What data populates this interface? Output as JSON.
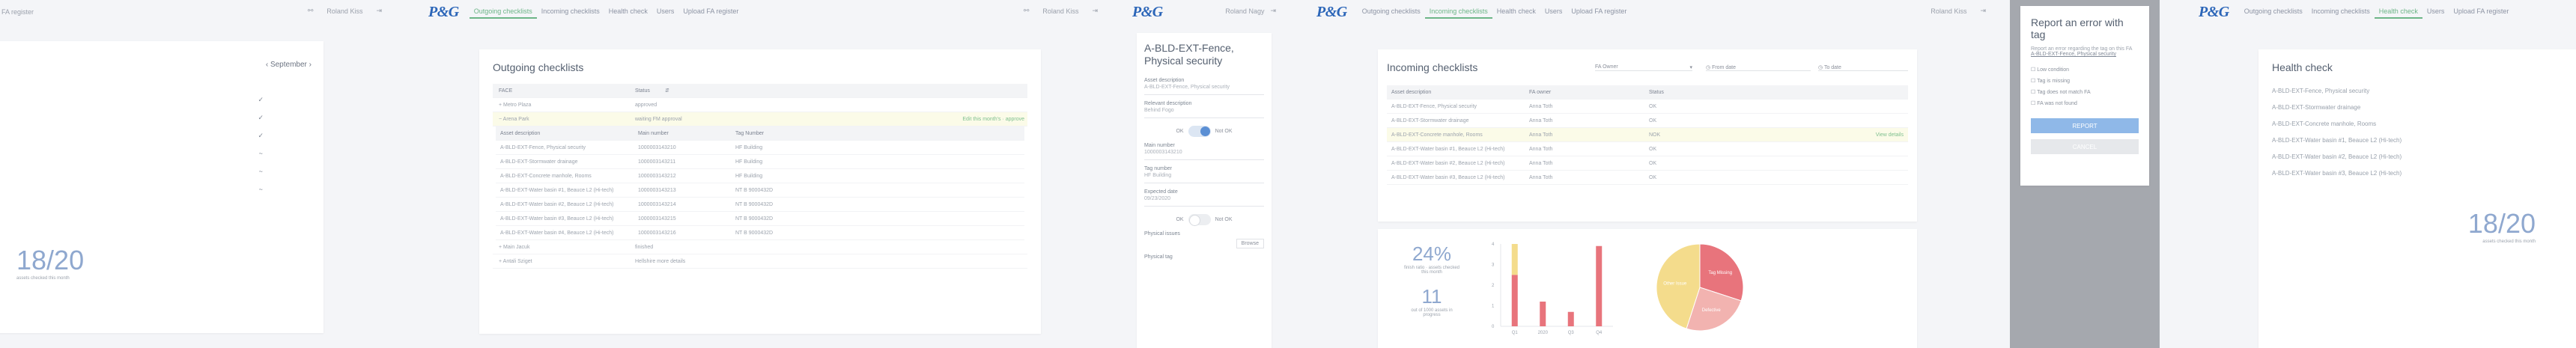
{
  "common": {
    "logo": "P&G",
    "user_name": "Roland Kiss",
    "nav": [
      "Outgoing checklists",
      "Incoming checklists",
      "Health check",
      "Users",
      "Upload FA register"
    ]
  },
  "panel1": {
    "nav_partial": "FA register",
    "month": "September",
    "checks": [
      "✓",
      "✓",
      "✓",
      "~",
      "~",
      "~"
    ],
    "big_stat": "18/20",
    "big_stat_caption": "assets checked this month"
  },
  "panel2": {
    "title": "Outgoing checklists",
    "header": {
      "col1": "FACE",
      "col2": "Status"
    },
    "groups": [
      {
        "name": "Metro Plaza",
        "status": "approved",
        "action": ""
      },
      {
        "name": "Arena Park",
        "status": "waiting FM approval",
        "action": "Edit this month's · approve"
      }
    ],
    "sub_header": {
      "c1": "Asset description",
      "c2": "Main number",
      "c3": "Tag Number"
    },
    "sub_rows": [
      {
        "c1": "A-BLD-EXT-Fence, Physical security",
        "c2": "1000003143210",
        "c3": "HF Building"
      },
      {
        "c1": "A-BLD-EXT-Stormwater drainage",
        "c2": "1000003143211",
        "c3": "HF Building"
      },
      {
        "c1": "A-BLD-EXT-Concrete manhole, Rooms",
        "c2": "1000003143212",
        "c3": "HF Building"
      },
      {
        "c1": "A-BLD-EXT-Water basin #1, Beauce L2 (Hi-tech)",
        "c2": "1000003143213",
        "c3": "NT B 9000432D"
      },
      {
        "c1": "A-BLD-EXT-Water basin #2, Beauce L2 (Hi-tech)",
        "c2": "1000003143214",
        "c3": "NT B 9000432D"
      },
      {
        "c1": "A-BLD-EXT-Water basin #3, Beauce L2 (Hi-tech)",
        "c2": "1000003143215",
        "c3": "NT B 9000432D"
      },
      {
        "c1": "A-BLD-EXT-Water basin #4, Beauce L2 (Hi-tech)",
        "c2": "1000003143216",
        "c3": "NT B 9000432D"
      }
    ],
    "footer_groups": [
      {
        "name": "Main Jacuk",
        "status": "finished"
      },
      {
        "name": "Antali Sziget",
        "status": "Hellshire more details"
      }
    ]
  },
  "panel3": {
    "user_name": "Roland Nagy",
    "title": "A-BLD-EXT-Fence, Physical security",
    "fields": [
      {
        "label": "Asset description",
        "value": "A-BLD-EXT-Fence, Physical security"
      },
      {
        "label": "Relevant description",
        "value": "Behind Fogo"
      }
    ],
    "toggle1": {
      "left": "OK",
      "right": "Not OK"
    },
    "fields2": [
      {
        "label": "Main number",
        "value": "1000003143210"
      },
      {
        "label": "Tag number",
        "value": "HF Building"
      },
      {
        "label": "Expected date",
        "value": "09/23/2020"
      }
    ],
    "toggle2": {
      "left": "OK",
      "right": "Not OK"
    },
    "photo_label": "Physical issues",
    "browse": "Browse",
    "last_label": "Physical tag"
  },
  "panel4": {
    "title": "Incoming checklists",
    "filters": {
      "select": "FA Owner",
      "from": "From date",
      "to": "To date"
    },
    "header": {
      "c1": "Asset description",
      "c2": "FA owner",
      "c3": "Status"
    },
    "rows": [
      {
        "c1": "A-BLD-EXT-Fence, Physical security",
        "c2": "Anna Toth",
        "c3": "OK",
        "action": ""
      },
      {
        "c1": "A-BLD-EXT-Stormwater drainage",
        "c2": "Anna Toth",
        "c3": "OK",
        "action": ""
      },
      {
        "c1": "A-BLD-EXT-Concrete manhole, Rooms",
        "c2": "Anna Toth",
        "c3": "NOK",
        "action": "View details"
      },
      {
        "c1": "A-BLD-EXT-Water basin #1, Beauce L2 (Hi-tech)",
        "c2": "Anna Toth",
        "c3": "OK",
        "action": ""
      },
      {
        "c1": "A-BLD-EXT-Water basin #2, Beauce L2 (Hi-tech)",
        "c2": "Anna Toth",
        "c3": "OK",
        "action": ""
      },
      {
        "c1": "A-BLD-EXT-Water basin #3, Beauce L2 (Hi-tech)",
        "c2": "Anna Toth",
        "c3": "OK",
        "action": ""
      }
    ],
    "stat1": "24%",
    "stat1_caption": "finish ratio · assets checked this month",
    "stat2": "11",
    "stat2_caption": "out of 1000 assets in progress",
    "colors": {
      "pink": "#e8747c",
      "yellow": "#f4dc8c",
      "light_pink": "#f2b3b0"
    }
  },
  "chart_data": {
    "type": "bar",
    "categories": [
      "Q1",
      "2020",
      "Q3",
      "Q4"
    ],
    "ylim": [
      0,
      4
    ],
    "yticks": [
      "4",
      "3",
      "2",
      "1",
      "0"
    ],
    "series": [
      {
        "values": [
          2.5,
          1.2,
          0.7,
          3.9
        ],
        "color": "#e8747c"
      },
      {
        "values": [
          1.5,
          0,
          0,
          0
        ],
        "color": "#f4dc8c"
      }
    ]
  },
  "pie_data": {
    "type": "pie",
    "slices": [
      {
        "label": "Tag Missing",
        "value": 30,
        "color": "#e8747c"
      },
      {
        "label": "Defective",
        "value": 25,
        "color": "#f2b3b0"
      },
      {
        "label": "Other Issue",
        "value": 45,
        "color": "#f4dc8c"
      }
    ]
  },
  "panel5": {
    "modal_title": "Report an error with tag",
    "modal_text": "Report an error regarding the tag on this FA",
    "modal_link": "A-BLD-EXT-Fence, Physical security",
    "options": [
      "Low condition",
      "Tag is missing",
      "Tag does not match FA",
      "FA was not found"
    ],
    "report": "REPORT",
    "cancel": "CANCEL"
  },
  "panel6": {
    "title": "Health check",
    "items": [
      "A-BLD-EXT-Fence, Physical security",
      "A-BLD-EXT-Stormwater drainage",
      "A-BLD-EXT-Concrete manhole, Rooms",
      "A-BLD-EXT-Water basin #1, Beauce L2 (Hi-tech)",
      "A-BLD-EXT-Water basin #2, Beauce L2 (Hi-tech)",
      "A-BLD-EXT-Water basin #3, Beauce L2 (Hi-tech)"
    ],
    "big_stat": "18/20",
    "big_stat_caption": "assets checked this month"
  }
}
